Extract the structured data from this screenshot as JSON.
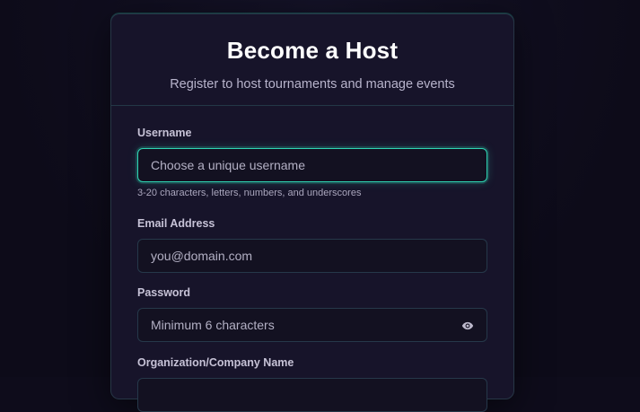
{
  "header": {
    "title": "Become a Host",
    "subtitle": "Register to host tournaments and manage events"
  },
  "form": {
    "username": {
      "label": "Username",
      "placeholder": "Choose a unique username",
      "hint": "3-20 characters, letters, numbers, and underscores"
    },
    "email": {
      "label": "Email Address",
      "placeholder": "you@domain.com"
    },
    "password": {
      "label": "Password",
      "placeholder": "Minimum 6 characters",
      "toggle_icon": "eye-icon"
    },
    "organization": {
      "label": "Organization/Company Name"
    }
  },
  "colors": {
    "accent": "#2fd6b4",
    "background": "#0e0c1b",
    "card": "#17142a"
  }
}
